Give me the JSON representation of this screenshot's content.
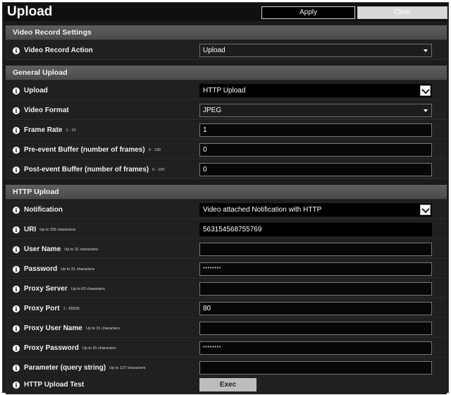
{
  "header": {
    "title": "Upload",
    "apply_label": "Apply",
    "clear_label": "Clear"
  },
  "sections": {
    "video_record": {
      "title": "Video Record Settings"
    },
    "general_upload": {
      "title": "General Upload"
    },
    "http_upload": {
      "title": "HTTP Upload"
    }
  },
  "fields": {
    "video_record_action": {
      "label": "Video Record Action",
      "value": "Upload"
    },
    "upload": {
      "label": "Upload",
      "value": "HTTP Upload"
    },
    "video_format": {
      "label": "Video Format",
      "value": "JPEG"
    },
    "frame_rate": {
      "label": "Frame Rate",
      "hint": "1 - 10",
      "value": "1"
    },
    "pre_event": {
      "label": "Pre-event Buffer (number of frames)",
      "hint": "0 - 100",
      "value": "0"
    },
    "post_event": {
      "label": "Post-event Buffer (number of frames)",
      "hint": "0 - 100",
      "value": "0"
    },
    "notification": {
      "label": "Notification",
      "value": "Video attached Notification with HTTP"
    },
    "uri": {
      "label": "URI",
      "hint": "Up to 255 characters",
      "value": "563154568755769"
    },
    "user_name": {
      "label": "User Name",
      "hint": "Up to 31 characters",
      "value": ""
    },
    "password": {
      "label": "Password",
      "hint": "Up to 31 characters",
      "value": "********"
    },
    "proxy_server": {
      "label": "Proxy Server",
      "hint": "Up to 63 characters",
      "value": ""
    },
    "proxy_port": {
      "label": "Proxy Port",
      "hint": "1 - 65535",
      "value": "80"
    },
    "proxy_user_name": {
      "label": "Proxy User Name",
      "hint": "Up to 31 characters",
      "value": ""
    },
    "proxy_password": {
      "label": "Proxy Password",
      "hint": "Up to 31 characters",
      "value": "********"
    },
    "parameter": {
      "label": "Parameter (query string)",
      "hint": "Up to 127 characters",
      "value": ""
    },
    "http_upload_test": {
      "label": "HTTP Upload Test",
      "button": "Exec"
    }
  },
  "info_icon": {
    "glyph": "i"
  },
  "colors": {
    "background": "#1b1b1b",
    "section_header": "#555555",
    "row": "#202020",
    "exec_button": "#bdbdbd"
  }
}
